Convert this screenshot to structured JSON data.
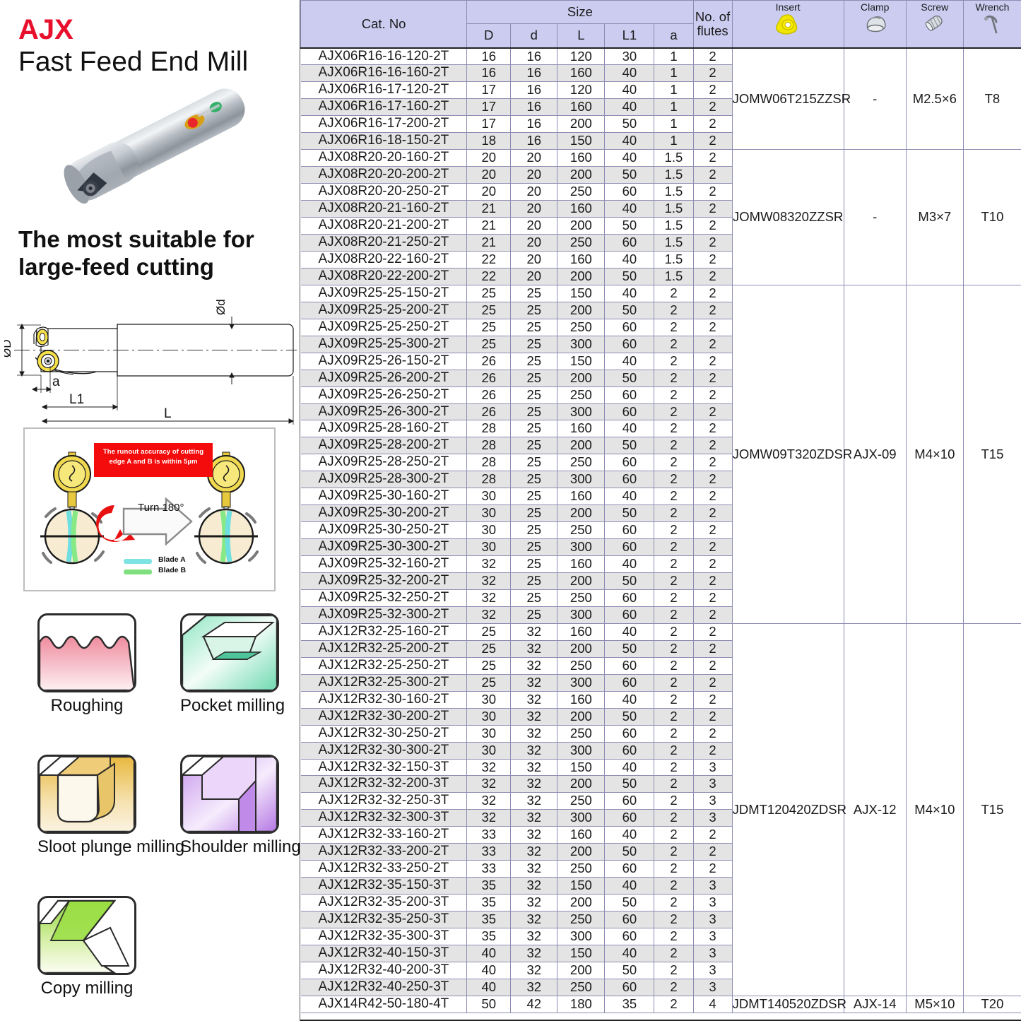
{
  "left": {
    "brand": "AJX",
    "product_title": "Fast Feed End Mill",
    "tagline": "The most suitable for large-feed cutting",
    "dimension_labels": {
      "outer_diameter": "ØD",
      "shank_diameter": "Ød",
      "a": "a",
      "l1": "L1",
      "l": "L"
    },
    "runout": {
      "banner_line1": "The runout accuracy of cutting",
      "banner_line2": "edge A and B is within 5µm",
      "turn_label": "Turn 180°",
      "legend": [
        "Blade A",
        "Blade B"
      ],
      "blade_a_color": "#7fe3e3",
      "blade_b_color": "#80e080",
      "banner_color": "#f40b0b"
    },
    "applications": [
      {
        "label": "Roughing",
        "color": "#f3a0ad"
      },
      {
        "label": "Pocket milling",
        "color": "#8fe6c4"
      },
      {
        "label": "Sloot plunge milling",
        "color": "#e2ae3c"
      },
      {
        "label": "Shoulder milling",
        "color": "#c08ae8"
      },
      {
        "label": "Copy milling",
        "color": "#8ed433"
      }
    ]
  },
  "table": {
    "headers": {
      "cat_no": "Cat. No",
      "size": "Size",
      "size_cols": [
        "D",
        "d",
        "L",
        "L1",
        "a"
      ],
      "flutes_line1": "No. of",
      "flutes_line2": "flutes",
      "insert": "Insert",
      "clamp": "Clamp",
      "screw": "Screw",
      "wrench": "Wrench"
    },
    "groups": [
      {
        "insert": "JOMW06T215ZZSR",
        "clamp": "-",
        "screw": "M2.5×6",
        "wrench": "T8",
        "rows": [
          {
            "cat": "AJX06R16-16-120-2T",
            "D": "16",
            "d": "16",
            "L": "120",
            "L1": "30",
            "a": "1",
            "flutes": "2"
          },
          {
            "cat": "AJX06R16-16-160-2T",
            "D": "16",
            "d": "16",
            "L": "160",
            "L1": "40",
            "a": "1",
            "flutes": "2"
          },
          {
            "cat": "AJX06R16-17-120-2T",
            "D": "17",
            "d": "16",
            "L": "120",
            "L1": "40",
            "a": "1",
            "flutes": "2"
          },
          {
            "cat": "AJX06R16-17-160-2T",
            "D": "17",
            "d": "16",
            "L": "160",
            "L1": "40",
            "a": "1",
            "flutes": "2"
          },
          {
            "cat": "AJX06R16-17-200-2T",
            "D": "17",
            "d": "16",
            "L": "200",
            "L1": "50",
            "a": "1",
            "flutes": "2"
          },
          {
            "cat": "AJX06R16-18-150-2T",
            "D": "18",
            "d": "16",
            "L": "150",
            "L1": "40",
            "a": "1",
            "flutes": "2"
          }
        ]
      },
      {
        "insert": "JOMW08320ZZSR",
        "clamp": "-",
        "screw": "M3×7",
        "wrench": "T10",
        "rows": [
          {
            "cat": "AJX08R20-20-160-2T",
            "D": "20",
            "d": "20",
            "L": "160",
            "L1": "40",
            "a": "1.5",
            "flutes": "2"
          },
          {
            "cat": "AJX08R20-20-200-2T",
            "D": "20",
            "d": "20",
            "L": "200",
            "L1": "50",
            "a": "1.5",
            "flutes": "2"
          },
          {
            "cat": "AJX08R20-20-250-2T",
            "D": "20",
            "d": "20",
            "L": "250",
            "L1": "60",
            "a": "1.5",
            "flutes": "2"
          },
          {
            "cat": "AJX08R20-21-160-2T",
            "D": "21",
            "d": "20",
            "L": "160",
            "L1": "40",
            "a": "1.5",
            "flutes": "2"
          },
          {
            "cat": "AJX08R20-21-200-2T",
            "D": "21",
            "d": "20",
            "L": "200",
            "L1": "50",
            "a": "1.5",
            "flutes": "2"
          },
          {
            "cat": "AJX08R20-21-250-2T",
            "D": "21",
            "d": "20",
            "L": "250",
            "L1": "60",
            "a": "1.5",
            "flutes": "2"
          },
          {
            "cat": "AJX08R20-22-160-2T",
            "D": "22",
            "d": "20",
            "L": "160",
            "L1": "40",
            "a": "1.5",
            "flutes": "2"
          },
          {
            "cat": "AJX08R20-22-200-2T",
            "D": "22",
            "d": "20",
            "L": "200",
            "L1": "50",
            "a": "1.5",
            "flutes": "2"
          }
        ]
      },
      {
        "insert": "JOMW09T320ZDSR",
        "clamp": "AJX-09",
        "screw": "M4×10",
        "wrench": "T15",
        "rows": [
          {
            "cat": "AJX09R25-25-150-2T",
            "D": "25",
            "d": "25",
            "L": "150",
            "L1": "40",
            "a": "2",
            "flutes": "2"
          },
          {
            "cat": "AJX09R25-25-200-2T",
            "D": "25",
            "d": "25",
            "L": "200",
            "L1": "50",
            "a": "2",
            "flutes": "2"
          },
          {
            "cat": "AJX09R25-25-250-2T",
            "D": "25",
            "d": "25",
            "L": "250",
            "L1": "60",
            "a": "2",
            "flutes": "2"
          },
          {
            "cat": "AJX09R25-25-300-2T",
            "D": "25",
            "d": "25",
            "L": "300",
            "L1": "60",
            "a": "2",
            "flutes": "2"
          },
          {
            "cat": "AJX09R25-26-150-2T",
            "D": "26",
            "d": "25",
            "L": "150",
            "L1": "40",
            "a": "2",
            "flutes": "2"
          },
          {
            "cat": "AJX09R25-26-200-2T",
            "D": "26",
            "d": "25",
            "L": "200",
            "L1": "50",
            "a": "2",
            "flutes": "2"
          },
          {
            "cat": "AJX09R25-26-250-2T",
            "D": "26",
            "d": "25",
            "L": "250",
            "L1": "60",
            "a": "2",
            "flutes": "2"
          },
          {
            "cat": "AJX09R25-26-300-2T",
            "D": "26",
            "d": "25",
            "L": "300",
            "L1": "60",
            "a": "2",
            "flutes": "2"
          },
          {
            "cat": "AJX09R25-28-160-2T",
            "D": "28",
            "d": "25",
            "L": "160",
            "L1": "40",
            "a": "2",
            "flutes": "2"
          },
          {
            "cat": "AJX09R25-28-200-2T",
            "D": "28",
            "d": "25",
            "L": "200",
            "L1": "50",
            "a": "2",
            "flutes": "2"
          },
          {
            "cat": "AJX09R25-28-250-2T",
            "D": "28",
            "d": "25",
            "L": "250",
            "L1": "60",
            "a": "2",
            "flutes": "2"
          },
          {
            "cat": "AJX09R25-28-300-2T",
            "D": "28",
            "d": "25",
            "L": "300",
            "L1": "60",
            "a": "2",
            "flutes": "2"
          },
          {
            "cat": "AJX09R25-30-160-2T",
            "D": "30",
            "d": "25",
            "L": "160",
            "L1": "40",
            "a": "2",
            "flutes": "2"
          },
          {
            "cat": "AJX09R25-30-200-2T",
            "D": "30",
            "d": "25",
            "L": "200",
            "L1": "50",
            "a": "2",
            "flutes": "2"
          },
          {
            "cat": "AJX09R25-30-250-2T",
            "D": "30",
            "d": "25",
            "L": "250",
            "L1": "60",
            "a": "2",
            "flutes": "2"
          },
          {
            "cat": "AJX09R25-30-300-2T",
            "D": "30",
            "d": "25",
            "L": "300",
            "L1": "60",
            "a": "2",
            "flutes": "2"
          },
          {
            "cat": "AJX09R25-32-160-2T",
            "D": "32",
            "d": "25",
            "L": "160",
            "L1": "40",
            "a": "2",
            "flutes": "2"
          },
          {
            "cat": "AJX09R25-32-200-2T",
            "D": "32",
            "d": "25",
            "L": "200",
            "L1": "50",
            "a": "2",
            "flutes": "2"
          },
          {
            "cat": "AJX09R25-32-250-2T",
            "D": "32",
            "d": "25",
            "L": "250",
            "L1": "60",
            "a": "2",
            "flutes": "2"
          },
          {
            "cat": "AJX09R25-32-300-2T",
            "D": "32",
            "d": "25",
            "L": "300",
            "L1": "60",
            "a": "2",
            "flutes": "2"
          }
        ]
      },
      {
        "insert": "JDMT120420ZDSR",
        "clamp": "AJX-12",
        "screw": "M4×10",
        "wrench": "T15",
        "rows": [
          {
            "cat": "AJX12R32-25-160-2T",
            "D": "25",
            "d": "32",
            "L": "160",
            "L1": "40",
            "a": "2",
            "flutes": "2"
          },
          {
            "cat": "AJX12R32-25-200-2T",
            "D": "25",
            "d": "32",
            "L": "200",
            "L1": "50",
            "a": "2",
            "flutes": "2"
          },
          {
            "cat": "AJX12R32-25-250-2T",
            "D": "25",
            "d": "32",
            "L": "250",
            "L1": "60",
            "a": "2",
            "flutes": "2"
          },
          {
            "cat": "AJX12R32-25-300-2T",
            "D": "25",
            "d": "32",
            "L": "300",
            "L1": "60",
            "a": "2",
            "flutes": "2"
          },
          {
            "cat": "AJX12R32-30-160-2T",
            "D": "30",
            "d": "32",
            "L": "160",
            "L1": "40",
            "a": "2",
            "flutes": "2"
          },
          {
            "cat": "AJX12R32-30-200-2T",
            "D": "30",
            "d": "32",
            "L": "200",
            "L1": "50",
            "a": "2",
            "flutes": "2"
          },
          {
            "cat": "AJX12R32-30-250-2T",
            "D": "30",
            "d": "32",
            "L": "250",
            "L1": "60",
            "a": "2",
            "flutes": "2"
          },
          {
            "cat": "AJX12R32-30-300-2T",
            "D": "30",
            "d": "32",
            "L": "300",
            "L1": "60",
            "a": "2",
            "flutes": "2"
          },
          {
            "cat": "AJX12R32-32-150-3T",
            "D": "32",
            "d": "32",
            "L": "150",
            "L1": "40",
            "a": "2",
            "flutes": "3"
          },
          {
            "cat": "AJX12R32-32-200-3T",
            "D": "32",
            "d": "32",
            "L": "200",
            "L1": "50",
            "a": "2",
            "flutes": "3"
          },
          {
            "cat": "AJX12R32-32-250-3T",
            "D": "32",
            "d": "32",
            "L": "250",
            "L1": "60",
            "a": "2",
            "flutes": "3"
          },
          {
            "cat": "AJX12R32-32-300-3T",
            "D": "32",
            "d": "32",
            "L": "300",
            "L1": "60",
            "a": "2",
            "flutes": "3"
          },
          {
            "cat": "AJX12R32-33-160-2T",
            "D": "33",
            "d": "32",
            "L": "160",
            "L1": "40",
            "a": "2",
            "flutes": "2"
          },
          {
            "cat": "AJX12R32-33-200-2T",
            "D": "33",
            "d": "32",
            "L": "200",
            "L1": "50",
            "a": "2",
            "flutes": "2"
          },
          {
            "cat": "AJX12R32-33-250-2T",
            "D": "33",
            "d": "32",
            "L": "250",
            "L1": "60",
            "a": "2",
            "flutes": "2"
          },
          {
            "cat": "AJX12R32-35-150-3T",
            "D": "35",
            "d": "32",
            "L": "150",
            "L1": "40",
            "a": "2",
            "flutes": "3"
          },
          {
            "cat": "AJX12R32-35-200-3T",
            "D": "35",
            "d": "32",
            "L": "200",
            "L1": "50",
            "a": "2",
            "flutes": "3"
          },
          {
            "cat": "AJX12R32-35-250-3T",
            "D": "35",
            "d": "32",
            "L": "250",
            "L1": "60",
            "a": "2",
            "flutes": "3"
          },
          {
            "cat": "AJX12R32-35-300-3T",
            "D": "35",
            "d": "32",
            "L": "300",
            "L1": "60",
            "a": "2",
            "flutes": "3"
          },
          {
            "cat": "AJX12R32-40-150-3T",
            "D": "40",
            "d": "32",
            "L": "150",
            "L1": "40",
            "a": "2",
            "flutes": "3"
          },
          {
            "cat": "AJX12R32-40-200-3T",
            "D": "40",
            "d": "32",
            "L": "200",
            "L1": "50",
            "a": "2",
            "flutes": "3"
          },
          {
            "cat": "AJX12R32-40-250-3T",
            "D": "40",
            "d": "32",
            "L": "250",
            "L1": "60",
            "a": "2",
            "flutes": "3"
          }
        ]
      },
      {
        "insert": "JDMT140520ZDSR",
        "clamp": "AJX-14",
        "screw": "M5×10",
        "wrench": "T20",
        "rows": [
          {
            "cat": "AJX14R42-50-180-4T",
            "D": "50",
            "d": "42",
            "L": "180",
            "L1": "35",
            "a": "2",
            "flutes": "4"
          }
        ]
      }
    ]
  }
}
